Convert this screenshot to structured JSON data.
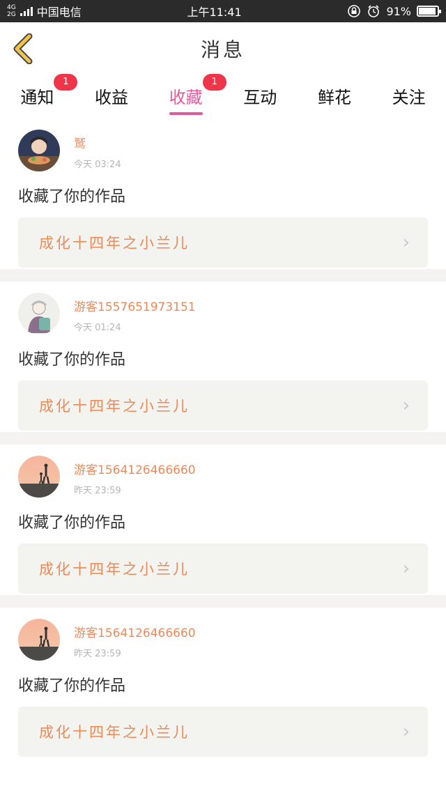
{
  "status_bar": {
    "network": "4G",
    "network2": "2G",
    "carrier": "中国电信",
    "time": "上午11:41",
    "battery": "91%",
    "battery_level": 0.91
  },
  "header": {
    "title": "消息"
  },
  "tabs": [
    {
      "label": "通知",
      "badge": "1",
      "active": false
    },
    {
      "label": "收益",
      "badge": "",
      "active": false
    },
    {
      "label": "收藏",
      "badge": "1",
      "active": true
    },
    {
      "label": "互动",
      "badge": "",
      "active": false
    },
    {
      "label": "鲜花",
      "badge": "",
      "active": false
    },
    {
      "label": "关注",
      "badge": "",
      "active": false
    }
  ],
  "feed": [
    {
      "username": "鹫",
      "time": "今天 03:24",
      "message": "收藏了你的作品",
      "work_title": "成化十四年之小兰儿",
      "avatar": "avatar-anime"
    },
    {
      "username": "游客1557651973151",
      "time": "今天 01:24",
      "message": "收藏了你的作品",
      "work_title": "成化十四年之小兰儿",
      "avatar": "avatar-sketch"
    },
    {
      "username": "游客1564126466660",
      "time": "昨天 23:59",
      "message": "收藏了你的作品",
      "work_title": "成化十四年之小兰儿",
      "avatar": "avatar-sunset"
    },
    {
      "username": "游客1564126466660",
      "time": "昨天 23:59",
      "message": "收藏了你的作品",
      "work_title": "成化十四年之小兰儿",
      "avatar": "avatar-sunset"
    }
  ],
  "colors": {
    "accent": "#e4599c",
    "name": "#e88a5b",
    "badge": "#f0354b",
    "back": "#f2c44c"
  }
}
